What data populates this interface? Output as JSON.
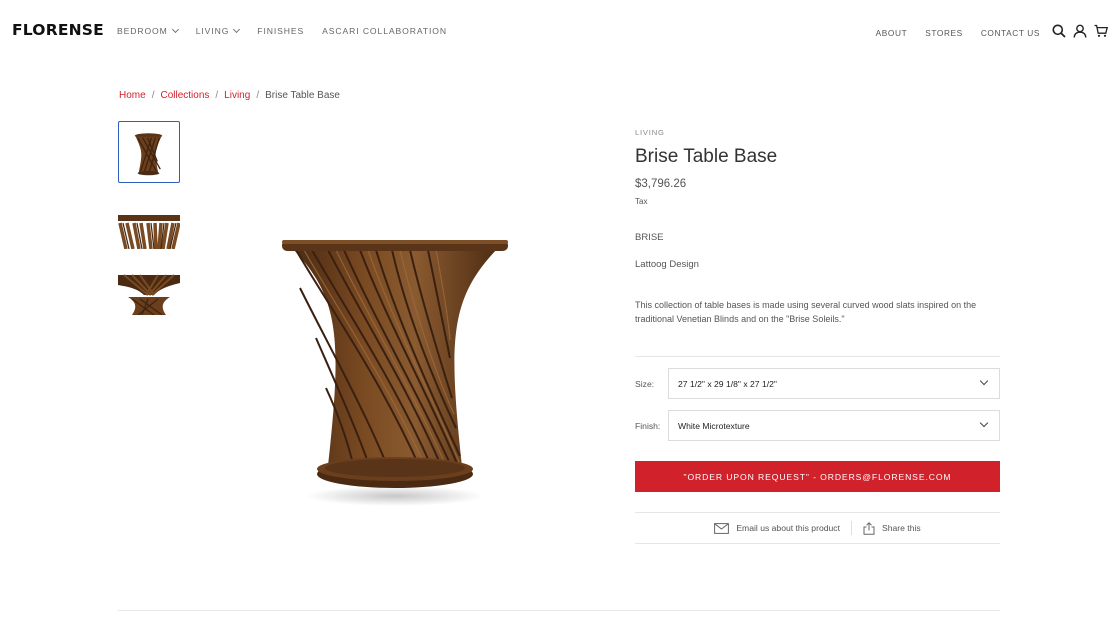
{
  "header": {
    "logo": "FLORENSE",
    "nav_left": [
      {
        "label": "BEDROOM",
        "has_dropdown": true
      },
      {
        "label": "LIVING",
        "has_dropdown": true
      },
      {
        "label": "FINISHES",
        "has_dropdown": false
      },
      {
        "label": "ASCARI COLLABORATION",
        "has_dropdown": false
      }
    ],
    "nav_right": [
      "ABOUT",
      "STORES",
      "CONTACT US"
    ],
    "icons": [
      "search-icon",
      "account-icon",
      "cart-icon"
    ]
  },
  "breadcrumb": {
    "links": [
      "Home",
      "Collections",
      "Living"
    ],
    "current": "Brise Table Base",
    "separator": "/"
  },
  "gallery": {
    "thumbnail_count": 3,
    "active_index": 0
  },
  "product": {
    "category": "LIVING",
    "title": "Brise Table Base",
    "price": "$3,796.26",
    "tax_note": "Tax",
    "brand": "BRISE",
    "designer": "Lattoog Design",
    "description": "This collection of table bases is made using several curved wood slats inspired on the traditional Venetian Blinds and on the \"Brise Soleils.\""
  },
  "options": {
    "size": {
      "label": "Size:",
      "value": "27 1/2\" x 29 1/8\" x 27 1/2\""
    },
    "finish": {
      "label": "Finish:",
      "value": "White Microtexture"
    }
  },
  "actions": {
    "order_button": "\"ORDER UPON REQUEST\" - ORDERS@FLORENSE.COM",
    "email_link": "Email us about this product",
    "share_link": "Share this"
  },
  "colors": {
    "accent_red": "#d1222c",
    "active_thumb_border": "#2c5fb5",
    "wood_dark": "#5a3418",
    "wood_light": "#8a5a30"
  }
}
